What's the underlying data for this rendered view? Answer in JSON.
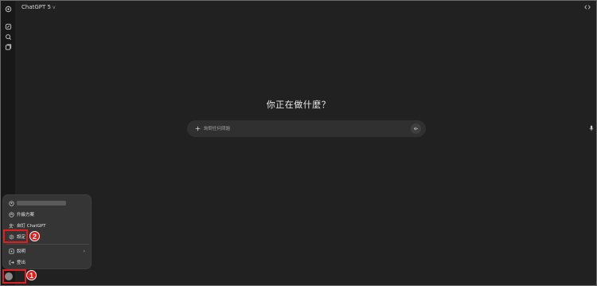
{
  "header": {
    "model_label": "ChatGPT 5",
    "model_chevron": "v"
  },
  "sidebar": {
    "icons": [
      "openai-logo-icon",
      "new-chat-icon",
      "search-icon",
      "library-icon"
    ]
  },
  "main": {
    "heading": "你正在做什麼？",
    "composer": {
      "placeholder": "詢問任何問題"
    }
  },
  "account_menu": {
    "items": [
      {
        "icon": "user-circle-icon",
        "label": ""
      },
      {
        "icon": "upgrade-icon",
        "label": "升級方案"
      },
      {
        "icon": "customize-icon",
        "label": "自訂 ChatGPT"
      },
      {
        "icon": "gear-icon",
        "label": "設定"
      },
      {
        "icon": "help-icon",
        "label": "說明"
      },
      {
        "icon": "logout-icon",
        "label": "登出"
      }
    ],
    "help_arrow": "›"
  },
  "annotations": {
    "step1": "1",
    "step2": "2",
    "color": "#e11d1d"
  }
}
